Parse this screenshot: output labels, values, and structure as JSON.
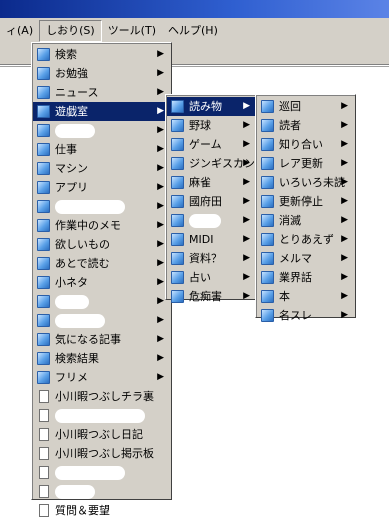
{
  "menubar": {
    "items": [
      "ィ(A)",
      "しおり(S)",
      "ツール(T)",
      "ヘルプ(H)"
    ]
  },
  "menu1": {
    "items": [
      {
        "label": "検索",
        "type": "folder",
        "submenu": true
      },
      {
        "label": "お勉強",
        "type": "folder",
        "submenu": true
      },
      {
        "label": "ニュース",
        "type": "folder",
        "submenu": true
      },
      {
        "label": "遊戯室",
        "type": "folder",
        "submenu": true,
        "selected": true
      },
      {
        "label": "",
        "type": "folder",
        "submenu": true,
        "redacted": true
      },
      {
        "label": "仕事",
        "type": "folder",
        "submenu": true
      },
      {
        "label": "マシン",
        "type": "folder",
        "submenu": true
      },
      {
        "label": "アプリ",
        "type": "folder",
        "submenu": true
      },
      {
        "label": "",
        "type": "folder",
        "submenu": true,
        "redacted": true
      },
      {
        "label": "作業中のメモ",
        "type": "folder",
        "submenu": true
      },
      {
        "label": "欲しいもの",
        "type": "folder",
        "submenu": true
      },
      {
        "label": "あとで読む",
        "type": "folder",
        "submenu": true
      },
      {
        "label": "小ネタ",
        "type": "folder",
        "submenu": true
      },
      {
        "label": "",
        "type": "folder",
        "submenu": true,
        "redacted": true
      },
      {
        "label": "",
        "type": "folder",
        "submenu": true,
        "redacted": true
      },
      {
        "label": "気になる記事",
        "type": "folder",
        "submenu": true
      },
      {
        "label": "検索結果",
        "type": "folder",
        "submenu": true
      },
      {
        "label": "フリメ",
        "type": "folder",
        "submenu": true
      },
      {
        "label": "小川暇つぶしチラ裏",
        "type": "page",
        "submenu": false
      },
      {
        "label": "",
        "type": "page",
        "submenu": false,
        "redacted": true
      },
      {
        "label": "小川暇つぶし日記",
        "type": "page",
        "submenu": false
      },
      {
        "label": "小川暇つぶし掲示板",
        "type": "page",
        "submenu": false
      },
      {
        "label": "",
        "type": "page",
        "submenu": false,
        "redacted": true
      },
      {
        "label": "",
        "type": "page",
        "submenu": false,
        "redacted": true
      },
      {
        "label": "質問＆要望",
        "type": "page",
        "submenu": false
      }
    ]
  },
  "menu2": {
    "items": [
      {
        "label": "読み物",
        "submenu": true,
        "selected": true
      },
      {
        "label": "野球",
        "submenu": true
      },
      {
        "label": "ゲーム",
        "submenu": true
      },
      {
        "label": "ジンギスカン",
        "submenu": true
      },
      {
        "label": "麻雀",
        "submenu": true
      },
      {
        "label": "國府田",
        "submenu": true
      },
      {
        "label": "",
        "submenu": true,
        "redacted": true
      },
      {
        "label": "MIDI",
        "submenu": true
      },
      {
        "label": "資料？",
        "submenu": true
      },
      {
        "label": "占い",
        "submenu": true
      },
      {
        "label": "危痴害",
        "submenu": true
      }
    ]
  },
  "menu3": {
    "items": [
      {
        "label": "巡回",
        "submenu": true
      },
      {
        "label": "読者",
        "submenu": true
      },
      {
        "label": "知り合い",
        "submenu": true
      },
      {
        "label": "レア更新",
        "submenu": true
      },
      {
        "label": "いろいろ未読",
        "submenu": true
      },
      {
        "label": "更新停止",
        "submenu": true
      },
      {
        "label": "消滅",
        "submenu": true
      },
      {
        "label": "とりあえず",
        "submenu": true
      },
      {
        "label": "メルマ",
        "submenu": true
      },
      {
        "label": "業界話",
        "submenu": true
      },
      {
        "label": "本",
        "submenu": true
      },
      {
        "label": "名スレ",
        "submenu": true
      }
    ]
  }
}
